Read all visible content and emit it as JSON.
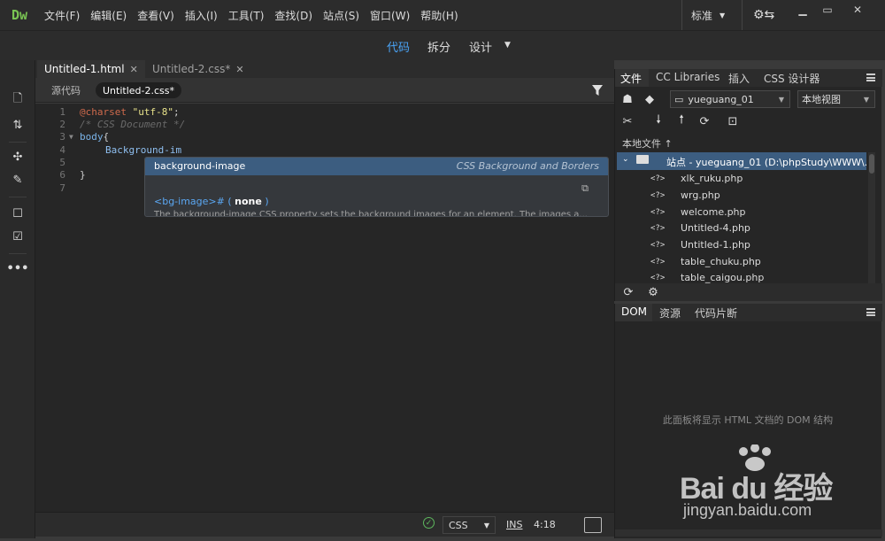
{
  "app": {
    "logo": "Dw"
  },
  "menu": [
    "文件(F)",
    "编辑(E)",
    "查看(V)",
    "插入(I)",
    "工具(T)",
    "查找(D)",
    "站点(S)",
    "窗口(W)",
    "帮助(H)"
  ],
  "workspace": {
    "label": "标准"
  },
  "views": {
    "code": "代码",
    "split": "拆分",
    "design": "设计"
  },
  "doc_tabs": [
    {
      "label": "Untitled-1.html",
      "active": true
    },
    {
      "label": "Untitled-2.css*",
      "active": false
    }
  ],
  "related_files": {
    "source": "源代码",
    "css": "Untitled-2.css*"
  },
  "code": {
    "line_numbers": [
      "1",
      "2",
      "3",
      "4",
      "5",
      "6",
      "7"
    ],
    "l1_at": "@charset",
    "l1_str": "\"utf-8\"",
    "l1_end": ";",
    "l2": "/* CSS Document */",
    "l3_sel": "body",
    "l3_brace": "{",
    "l4": "Background-im",
    "l6": "}"
  },
  "hint": {
    "name": "background-image",
    "category": "CSS Background and Borders",
    "syntax_a": "<bg-image>#",
    "syntax_b": " ( ",
    "syntax_c": "none",
    "syntax_d": " )",
    "description": "The background-image CSS property sets the background images for an element. The images a..."
  },
  "status": {
    "language": "CSS",
    "mode": "INS",
    "position": "4:18"
  },
  "files_panel": {
    "tabs": [
      "文件",
      "CC Libraries",
      "插入",
      "CSS 设计器"
    ],
    "site": "yueguang_01",
    "view": "本地视图",
    "local_files_label": "本地文件 ↑",
    "root": "站点 - yueguang_01 (D:\\phpStudy\\WWW\\...",
    "files": [
      {
        "icon": "<?>",
        "name": "xlk_ruku.php"
      },
      {
        "icon": "<?>",
        "name": "wrg.php"
      },
      {
        "icon": "<?>",
        "name": "welcome.php"
      },
      {
        "icon": "<?>",
        "name": "Untitled-4.php"
      },
      {
        "icon": "<?>",
        "name": "Untitled-1.php"
      },
      {
        "icon": "<?>",
        "name": "table_chuku.php"
      },
      {
        "icon": "<?>",
        "name": "table_caigou.php"
      }
    ]
  },
  "dom_panel": {
    "tabs": [
      "DOM",
      "资源",
      "代码片断"
    ],
    "empty_text": "此面板将显示 HTML 文档的 DOM 结构"
  },
  "watermark": {
    "brand": "Bai du 经验",
    "url": "jingyan.baidu.com"
  },
  "colors": {
    "accent": "#4aa3f5",
    "selection": "#3c5d80",
    "logo": "#79c353"
  }
}
